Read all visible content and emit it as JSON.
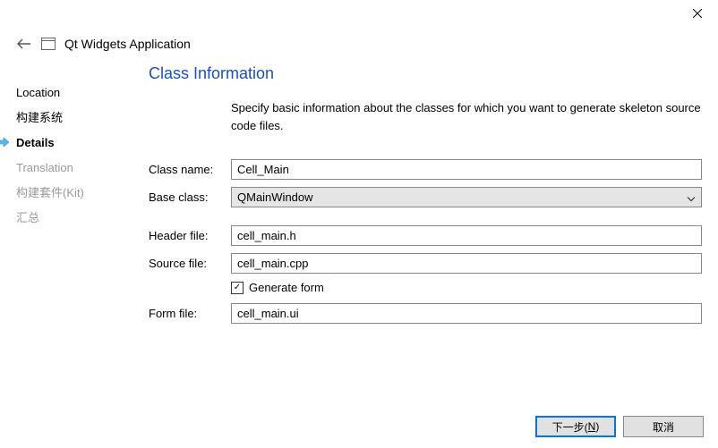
{
  "window": {
    "app_title": "Qt Widgets Application"
  },
  "sidebar": {
    "items": [
      {
        "label": "Location"
      },
      {
        "label": "构建系统"
      },
      {
        "label": "Details"
      },
      {
        "label": "Translation"
      },
      {
        "label": "构建套件(Kit)"
      },
      {
        "label": "汇总"
      }
    ]
  },
  "main": {
    "section_title": "Class Information",
    "description": "Specify basic information about the classes for which you want to generate skeleton source code files.",
    "labels": {
      "class_name": "Class name:",
      "base_class": "Base class:",
      "header_file": "Header file:",
      "source_file": "Source file:",
      "generate_form": "Generate form",
      "form_file": "Form file:"
    },
    "values": {
      "class_name": "Cell_Main",
      "base_class": "QMainWindow",
      "header_file": "cell_main.h",
      "source_file": "cell_main.cpp",
      "generate_form_checked": "✓",
      "form_file": "cell_main.ui"
    }
  },
  "footer": {
    "next_prefix": "下一步(",
    "next_key": "N",
    "next_suffix": ")",
    "cancel": "取消"
  }
}
